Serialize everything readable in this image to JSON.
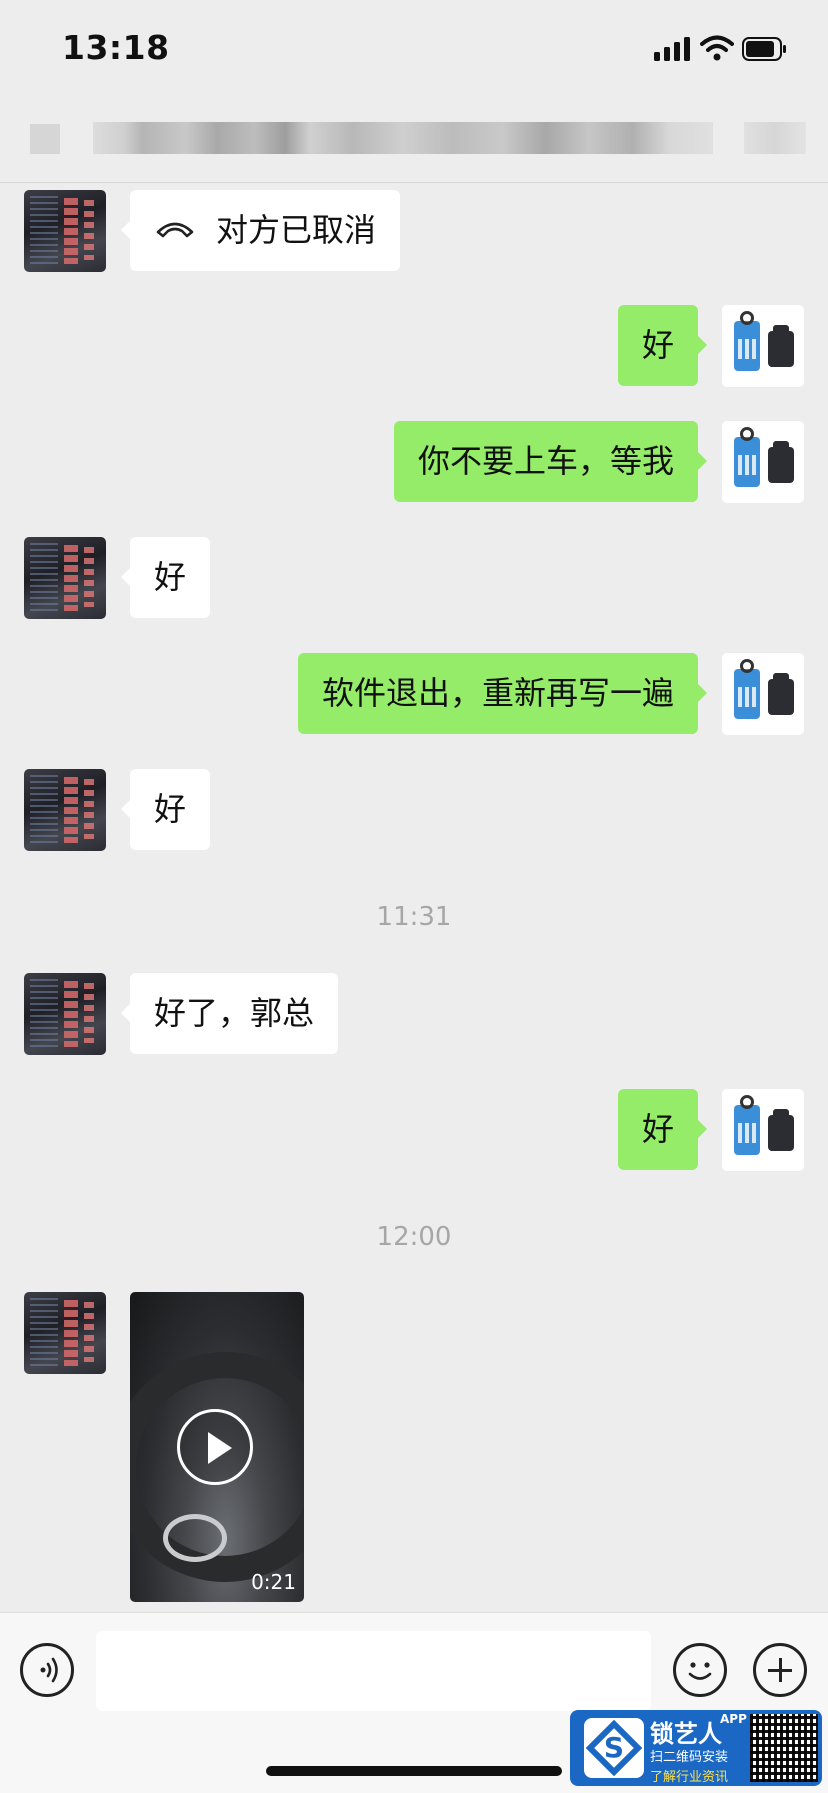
{
  "status_bar": {
    "time": "13:18"
  },
  "messages": [
    {
      "side": "in",
      "kind": "call",
      "text": "对方已取消"
    },
    {
      "side": "out",
      "text": "好"
    },
    {
      "side": "out",
      "text": "你不要上车，等我"
    },
    {
      "side": "in",
      "text": "好"
    },
    {
      "side": "out",
      "text": "软件退出，重新再写一遍"
    },
    {
      "side": "in",
      "text": "好"
    },
    {
      "kind": "time",
      "text": "11:31"
    },
    {
      "side": "in",
      "text": "好了，郭总"
    },
    {
      "side": "out",
      "text": "好"
    },
    {
      "kind": "time",
      "text": "12:00"
    },
    {
      "side": "in",
      "kind": "video",
      "duration": "0:21"
    }
  ],
  "input": {
    "value": ""
  },
  "watermark": {
    "name": "锁艺人",
    "badge": "APP",
    "line1": "扫二维码安装",
    "line2": "了解行业资讯"
  },
  "colors": {
    "background": "#ededed",
    "bubble_out": "#95ec69",
    "bubble_in": "#ffffff"
  }
}
